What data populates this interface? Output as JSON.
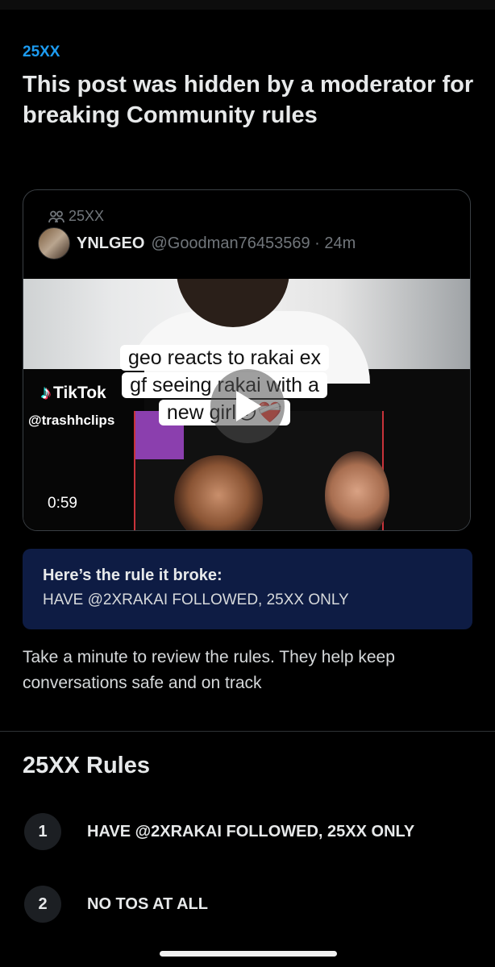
{
  "community_link": "25XX",
  "headline": "This post was hidden by a moderator for breaking Community rules",
  "post": {
    "community": "25XX",
    "author_name": "YNLGEO",
    "author_handle": "@Goodman76453569 · 24m",
    "video": {
      "caption_lines": [
        "geo reacts to rakai ex",
        "gf seeing rakai with a",
        "new girl😳❤️‍🩹"
      ],
      "tiktok_label": "TikTok",
      "tiktok_handle": "@trashhclips",
      "duration": "0:59"
    }
  },
  "broken_rule": {
    "title": "Here’s the rule it broke:",
    "rule": "HAVE @2XRAKAI FOLLOWED, 25XX ONLY"
  },
  "review_text": "Take a minute to review the rules. They help keep conversations safe and on track",
  "rules_section": {
    "title": "25XX Rules",
    "items": [
      {
        "number": "1",
        "text": "HAVE @2XRAKAI FOLLOWED, 25XX ONLY"
      },
      {
        "number": "2",
        "text": "NO TOS AT ALL"
      }
    ]
  },
  "colors": {
    "accent": "#1d9bf0",
    "background": "#000000",
    "rule_box": "#0e1c44",
    "muted": "#71767b"
  }
}
